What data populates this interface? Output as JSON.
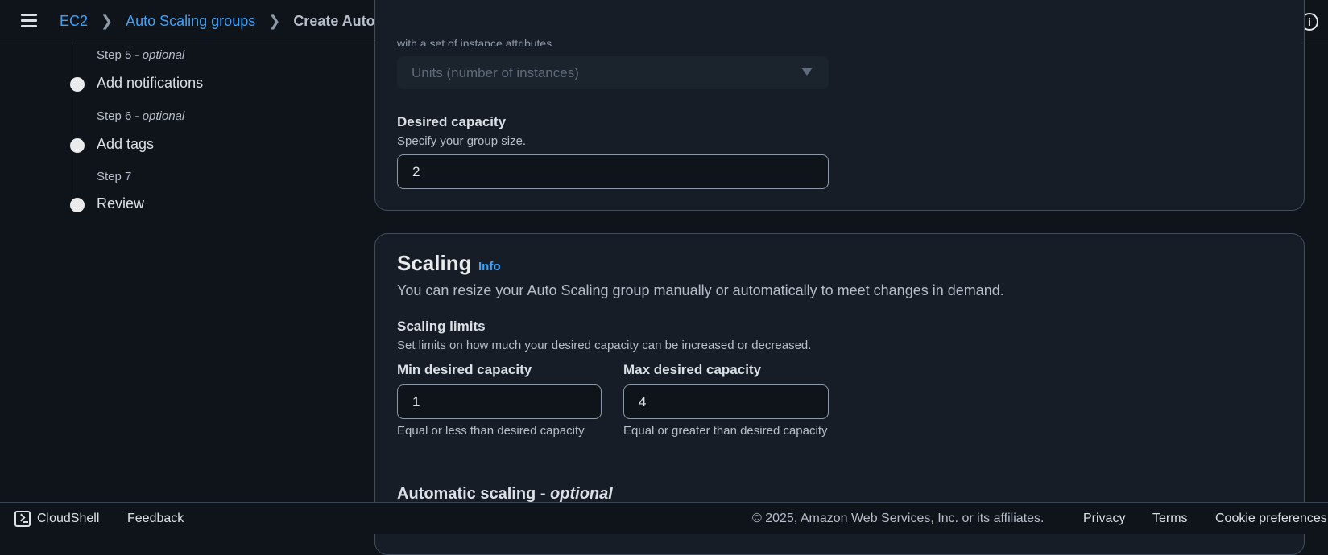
{
  "header": {
    "breadcrumb": [
      "EC2",
      "Auto Scaling groups",
      "Create Auto Scaling group"
    ],
    "info_icon": "info-circle-icon"
  },
  "steps": [
    {
      "label": "Step 5 -",
      "optional": "optional",
      "title": "Add notifications"
    },
    {
      "label": "Step 6 -",
      "optional": "optional",
      "title": "Add tags"
    },
    {
      "label": "Step 7",
      "optional": "",
      "title": "Review"
    }
  ],
  "capacity": {
    "cutoff_text": "with a set of instance attributes.",
    "units_select": "Units (number of instances)",
    "desired_label": "Desired capacity",
    "desired_desc": "Specify your group size.",
    "desired_value": "2"
  },
  "scaling": {
    "title": "Scaling",
    "info": "Info",
    "desc": "You can resize your Auto Scaling group manually or automatically to meet changes in demand.",
    "limits_label": "Scaling limits",
    "limits_desc": "Set limits on how much your desired capacity can be increased or decreased.",
    "min_label": "Min desired capacity",
    "min_value": "1",
    "min_hint": "Equal or less than desired capacity",
    "max_label": "Max desired capacity",
    "max_value": "4",
    "max_hint": "Equal or greater than desired capacity",
    "auto_title": "Automatic scaling -",
    "auto_optional": "optional"
  },
  "footer": {
    "cloudshell": "CloudShell",
    "feedback": "Feedback",
    "copyright": "© 2025, Amazon Web Services, Inc. or its affiliates.",
    "privacy": "Privacy",
    "terms": "Terms",
    "cookie": "Cookie preferences"
  }
}
